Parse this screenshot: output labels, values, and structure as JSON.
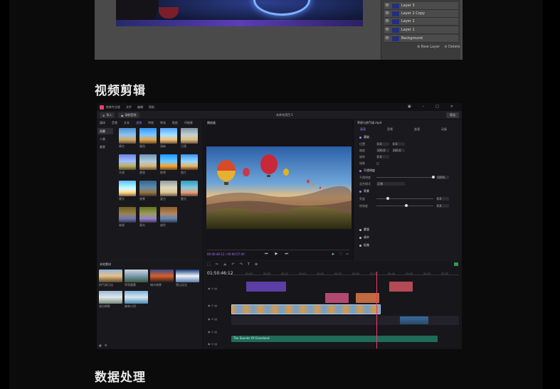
{
  "photoshop": {
    "layers": [
      "Layer 3",
      "Layer 2 Copy",
      "Layer 2",
      "Layer 1",
      "Background"
    ],
    "new_layer": "New Layer",
    "delete": "Delete"
  },
  "section_video": "视频剪辑",
  "section_data": "数据处理",
  "editor": {
    "app_name": "剪映专业版",
    "menu": [
      "文件",
      "编辑",
      "帮助"
    ],
    "import_label": "导入",
    "record_label": "录制音频",
    "project_name": "未命名项目 1",
    "export_label": "导出",
    "media_tabs": [
      "媒体",
      "音频",
      "文本",
      "滤镜",
      "特效",
      "转场",
      "贴纸",
      "AI效果"
    ],
    "side_items": [
      "风景",
      "人像",
      "美食"
    ],
    "fx_items": [
      "晴空",
      "暖阳",
      "清新",
      "日落",
      "冷调",
      "黄昏",
      "鲜艳",
      "胶片",
      "雾光",
      "夜景",
      "复古",
      "霞光",
      "暗调",
      "柔光",
      "褪色"
    ],
    "player_title": "播放器",
    "player_time": "00:00:46:12 / 00:00:57:00",
    "props_title": "草原与热气球.mp4",
    "props_tabs": [
      "画面",
      "音频",
      "变速",
      "动画"
    ],
    "props_rows": [
      {
        "label": "位置",
        "a": "0.0",
        "b": "0.0"
      },
      {
        "label": "缩放",
        "a": "100.0",
        "b": "100.0"
      },
      {
        "label": "旋转",
        "a": "0.0",
        "b": ""
      },
      {
        "label": "镜像",
        "a": "",
        "b": ""
      }
    ],
    "props_sections": [
      "基础",
      "不透明度",
      "背景",
      "蒙版",
      "调节",
      "抠像"
    ],
    "props_sub": [
      "不透明度",
      "混合模式",
      "亮度",
      "饱和度"
    ],
    "props_values": [
      "100%",
      "正常",
      "0.0",
      "0.0"
    ],
    "lib_title": "本地素材",
    "lib_items": [
      "热气球日出",
      "草原晨雾",
      "城市夜景",
      "雪山风光",
      "湖泊倒影",
      "森林小径"
    ],
    "timecode": "01:50:46:12",
    "ruler_ticks": [
      "00:00",
      "00:05",
      "00:10",
      "00:15",
      "00:20",
      "00:25",
      "00:30",
      "00:35",
      "00:40",
      "00:45",
      "00:50",
      "00:55",
      "01:00"
    ],
    "audio_label": "The Sounds Of Grassland"
  }
}
